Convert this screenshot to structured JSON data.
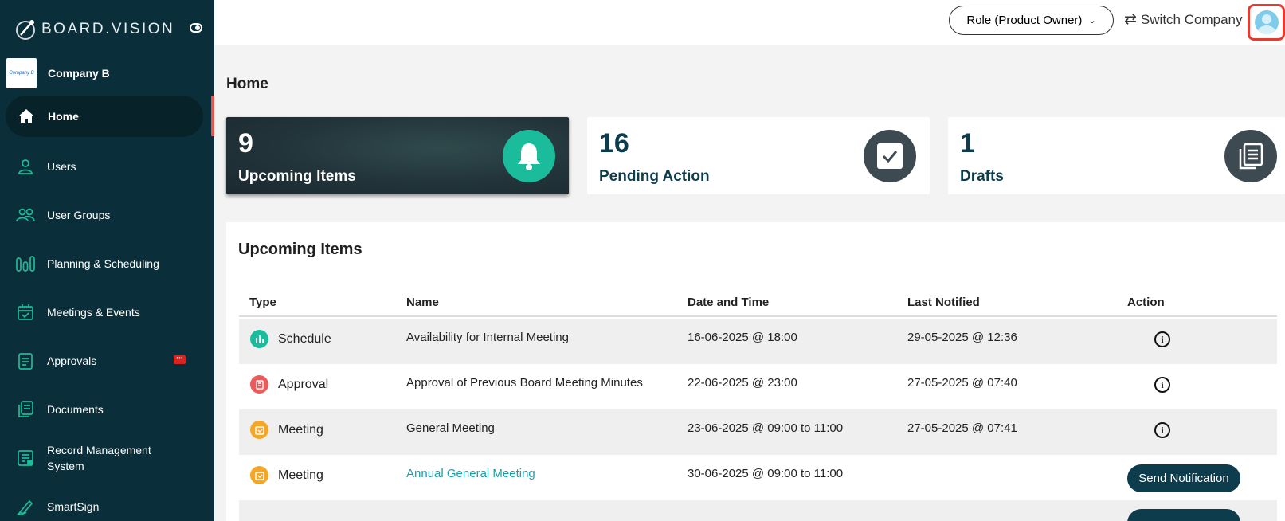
{
  "brand": {
    "name": "BOARD.VISION"
  },
  "company": {
    "logo_text": "Company B",
    "name": "Company B"
  },
  "sidebar": {
    "items": [
      {
        "label": "Home",
        "icon": "home-icon"
      },
      {
        "label": "Users",
        "icon": "user-icon"
      },
      {
        "label": "User Groups",
        "icon": "users-icon"
      },
      {
        "label": "Planning & Scheduling",
        "icon": "bars-icon"
      },
      {
        "label": "Meetings & Events",
        "icon": "calendar-check-icon"
      },
      {
        "label": "Approvals",
        "icon": "document-icon"
      },
      {
        "label": "Documents",
        "icon": "documents-icon"
      },
      {
        "label": "Record Management System",
        "icon": "record-icon"
      },
      {
        "label": "SmartSign",
        "icon": "pen-icon"
      }
    ],
    "approvals_badge": "•••"
  },
  "header": {
    "role_label": "Role (Product Owner)",
    "switch_company_label": "Switch Company"
  },
  "main": {
    "page_title": "Home",
    "cards": [
      {
        "count": "9",
        "label": "Upcoming Items",
        "icon": "bell-icon",
        "color": "#1bbc9b"
      },
      {
        "count": "16",
        "label": "Pending Action",
        "icon": "checkbox-icon",
        "color": "#3d4a52"
      },
      {
        "count": "1",
        "label": "Drafts",
        "icon": "copy-icon",
        "color": "#3d4a52"
      }
    ],
    "upcoming": {
      "title": "Upcoming Items",
      "columns": [
        "Type",
        "Name",
        "Date and Time",
        "Last Notified",
        "Action"
      ],
      "rows": [
        {
          "type": "Schedule",
          "name": "Availability for Internal Meeting",
          "datetime": "16-06-2025 @ 18:00",
          "last_notified": "29-05-2025 @ 12:36"
        },
        {
          "type": "Approval",
          "name": "Approval of Previous Board Meeting Minutes",
          "datetime": "22-06-2025 @ 23:00",
          "last_notified": "27-05-2025 @ 07:40"
        },
        {
          "type": "Meeting",
          "name": "General Meeting",
          "datetime": "23-06-2025 @ 09:00 to 11:00",
          "last_notified": "27-05-2025 @ 07:41"
        },
        {
          "type": "Meeting",
          "name": "Annual General Meeting",
          "datetime": "30-06-2025 @ 09:00 to 11:00",
          "last_notified": "",
          "action_label": "Send Notification"
        }
      ]
    }
  },
  "colors": {
    "sidebar_bg": "#0b2f3a",
    "accent_teal": "#1bbc9b",
    "primary_dark": "#0d3c4c",
    "highlight_red": "#e23b2f"
  }
}
